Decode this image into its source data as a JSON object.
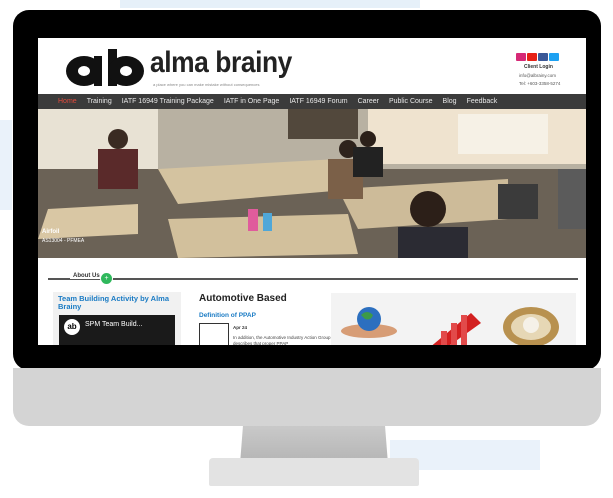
{
  "site": {
    "brand": "alma brainy",
    "logo_letters": "ab",
    "tagline": "a place where you can make mistake without consequences"
  },
  "header": {
    "social_icons": [
      "instagram-icon",
      "youtube-icon",
      "facebook-icon",
      "twitter-icon"
    ],
    "client_login": "Client Login",
    "email": "info@albrainy.com",
    "phone": "Tel: +603-3358-5274"
  },
  "nav": {
    "items": [
      {
        "label": "Home",
        "active": true
      },
      {
        "label": "Training"
      },
      {
        "label": "IATF 16949 Training Package"
      },
      {
        "label": "IATF in One Page"
      },
      {
        "label": "IATF 16949 Forum"
      },
      {
        "label": "Career"
      },
      {
        "label": "Public Course"
      },
      {
        "label": "Blog"
      },
      {
        "label": "Feedback"
      }
    ]
  },
  "hero": {
    "caption_name": "Airfoil",
    "caption_code": "AS13004 - PFMEA"
  },
  "about": {
    "label": "About Us",
    "dot": "+"
  },
  "card": {
    "title": "Team Building Activity by Alma Brainy",
    "video_logo": "ab",
    "video_title": "SPM Team Build..."
  },
  "main": {
    "title": "Automotive Based",
    "subtitle": "Definition of PPAP",
    "date": "Apr 24",
    "text": "In addition, the Automotive Industry Action Group describes that proper PPAP"
  },
  "colors": {
    "accent": "#1a7bc4",
    "nav_bg": "#3b3b3b",
    "nav_active": "#e34b3c",
    "about_dot": "#2fb85c"
  }
}
